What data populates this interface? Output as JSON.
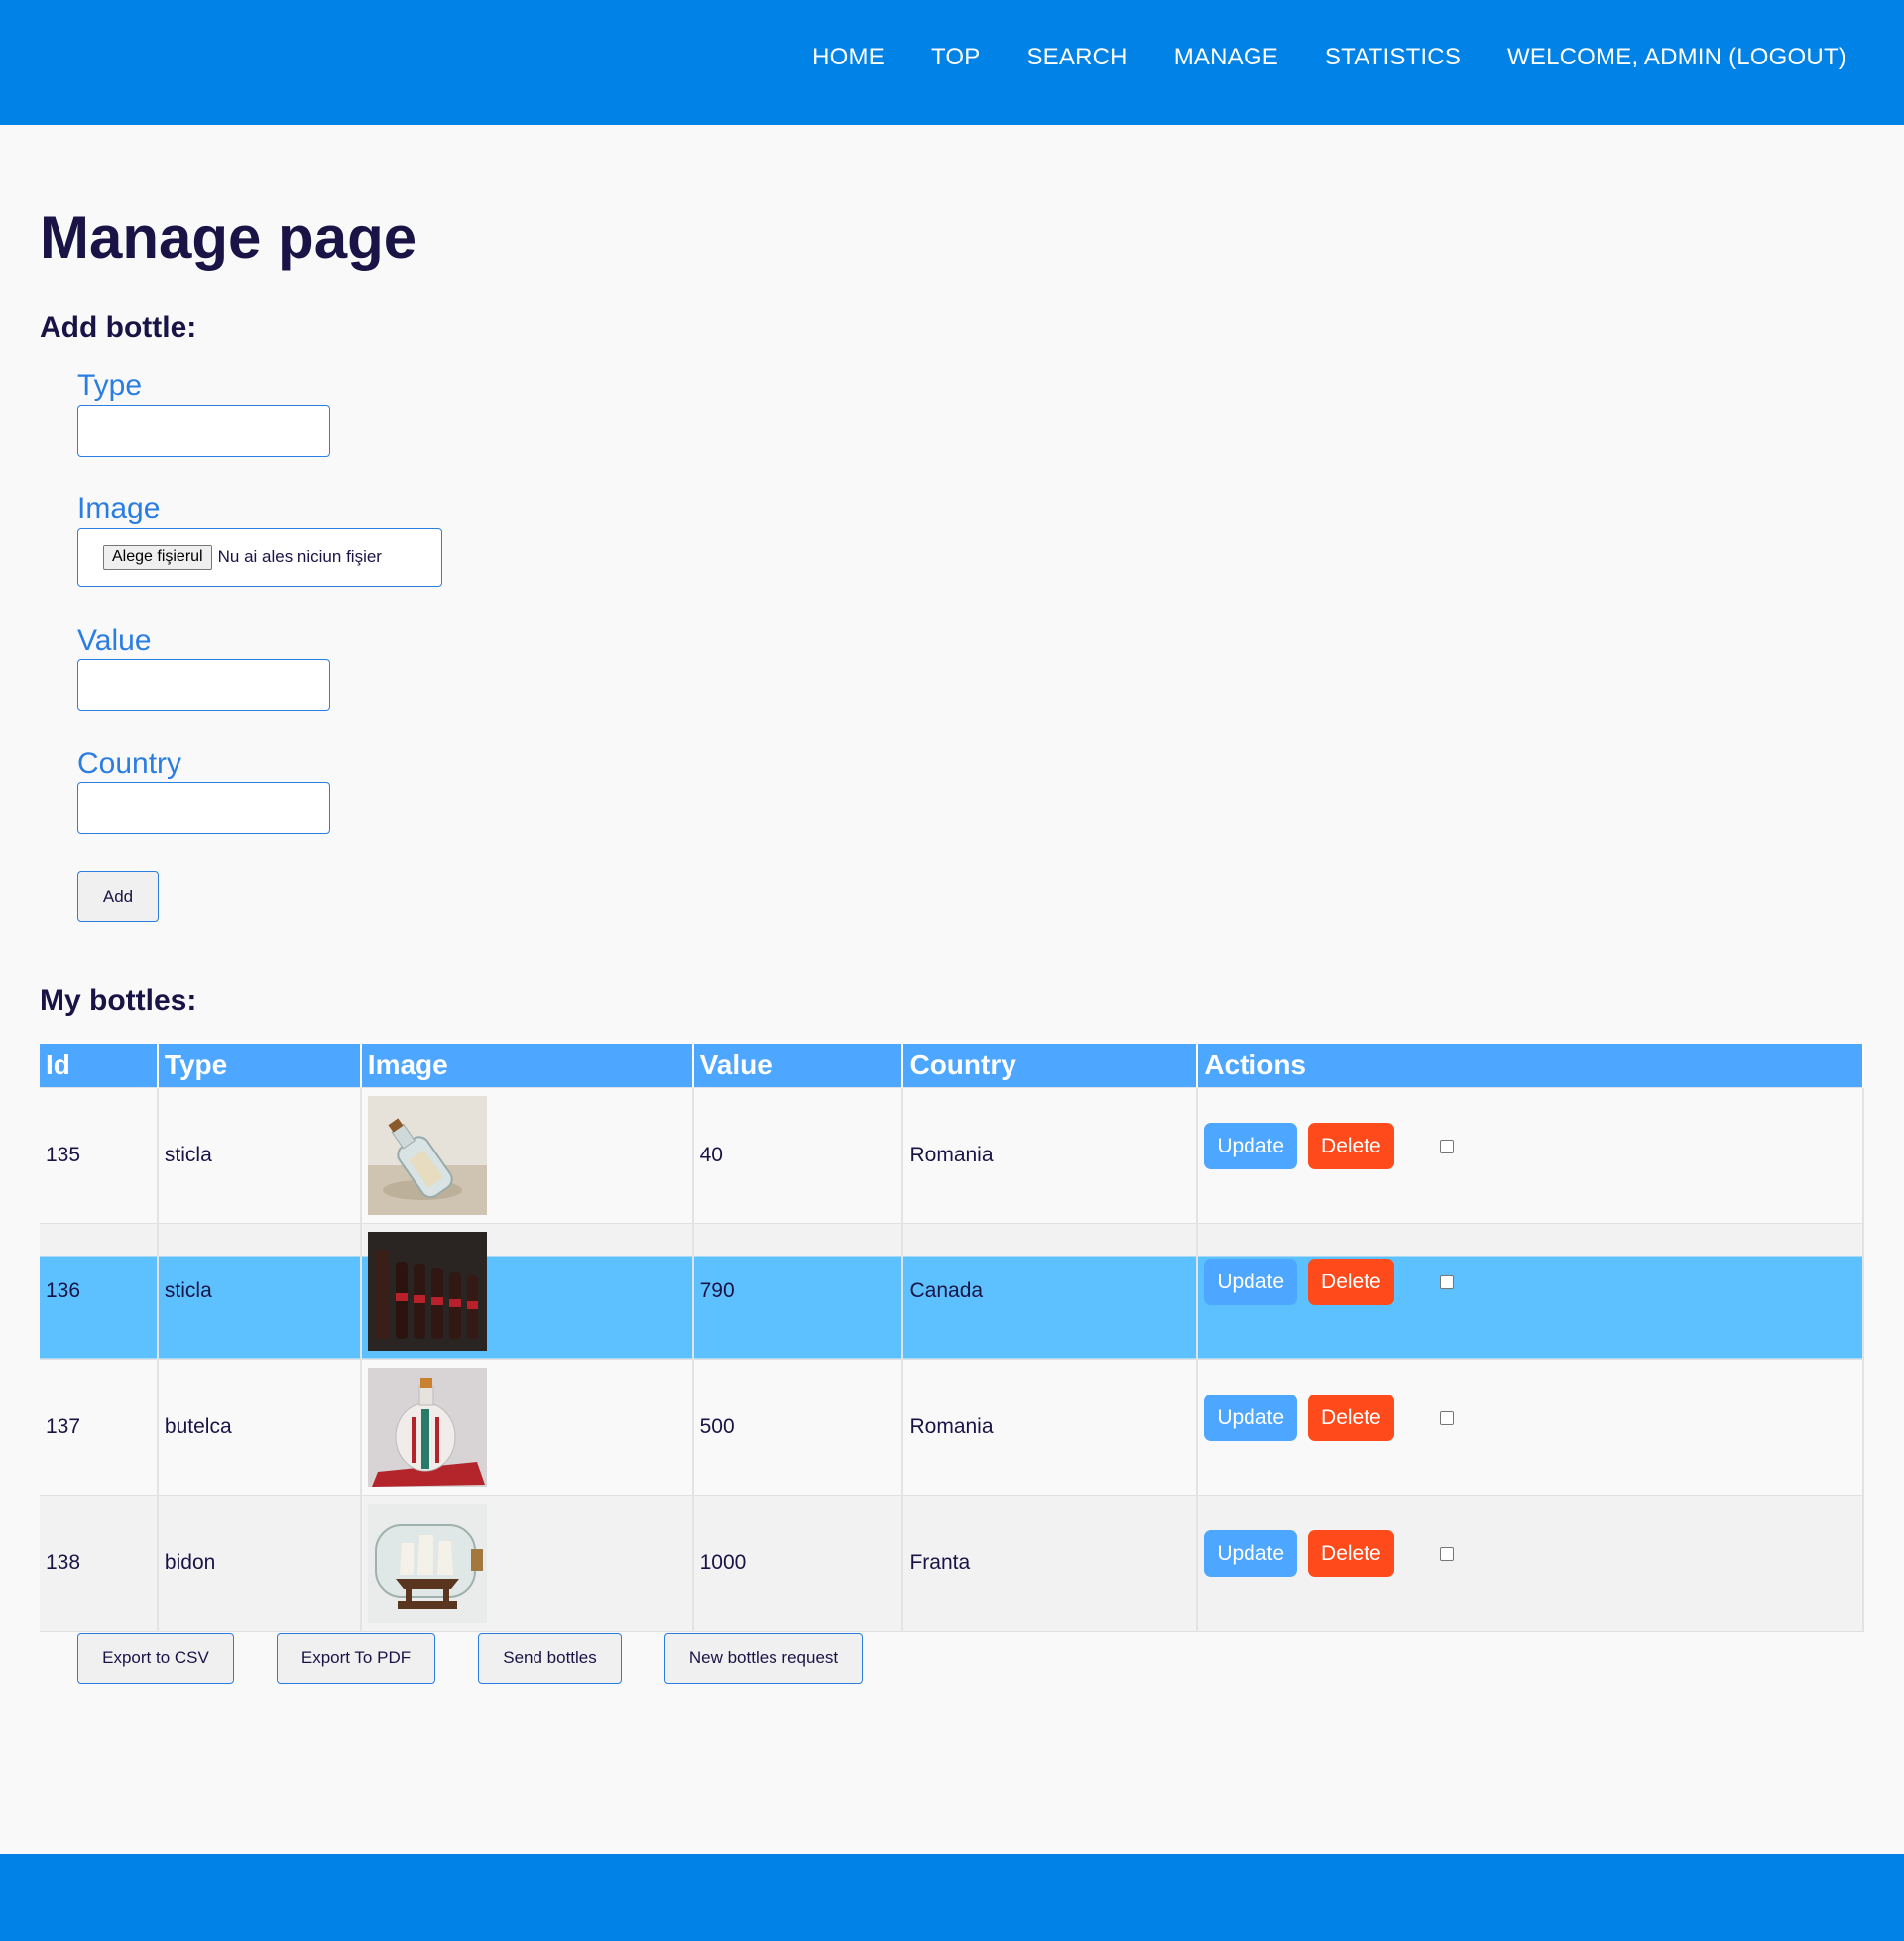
{
  "nav": {
    "items": [
      "HOME",
      "TOP",
      "SEARCH",
      "MANAGE",
      "STATISTICS",
      "WELCOME, ADMIN (LOGOUT)"
    ]
  },
  "page": {
    "title": "Manage page",
    "add_section_title": "Add bottle:",
    "list_section_title": "My bottles:"
  },
  "form": {
    "type_label": "Type",
    "image_label": "Image",
    "file_button": "Alege fişierul",
    "file_status": "Nu ai ales niciun fişier",
    "value_label": "Value",
    "country_label": "Country",
    "add_button": "Add"
  },
  "table": {
    "headers": [
      "Id",
      "Type",
      "Image",
      "Value",
      "Country",
      "Actions"
    ],
    "update_label": "Update",
    "delete_label": "Delete",
    "rows": [
      {
        "id": "135",
        "type": "sticla",
        "image": "bottle-on-sand-image",
        "value": "40",
        "country": "Romania"
      },
      {
        "id": "136",
        "type": "sticla",
        "image": "dark-bottles-row-image",
        "value": "790",
        "country": "Canada"
      },
      {
        "id": "137",
        "type": "butelca",
        "image": "decorated-flask-image",
        "value": "500",
        "country": "Romania"
      },
      {
        "id": "138",
        "type": "bidon",
        "image": "ship-in-bottle-image",
        "value": "1000",
        "country": "Franta"
      }
    ]
  },
  "bottom_buttons": {
    "export_csv": "Export to CSV",
    "export_pdf": "Export To PDF",
    "send_bottles": "Send bottles",
    "new_request": "New bottles request"
  },
  "colors": {
    "header": "#0082e6",
    "table_header": "#4da6ff",
    "highlight_row": "#5ec1ff",
    "update_button": "#4da6ff",
    "delete_button": "#ff4a1c"
  }
}
